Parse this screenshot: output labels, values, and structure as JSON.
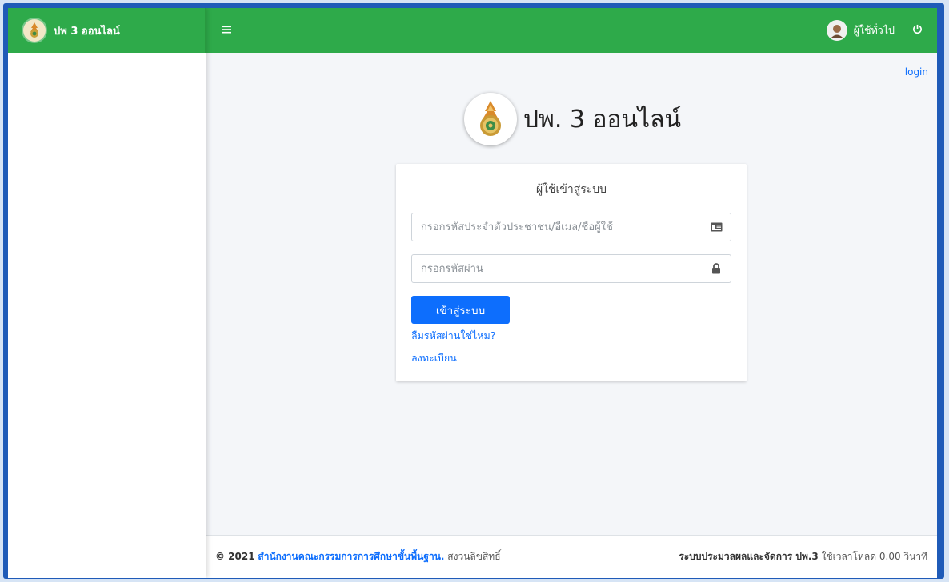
{
  "brand": {
    "title": "ปพ 3 ออนไลน์"
  },
  "navbar": {
    "menu_icon": "hamburger-icon",
    "user_label": "ผู้ใช้ทั่วไป",
    "power_icon": "power-icon"
  },
  "content": {
    "login_link": "login",
    "page_title": "ปพ. 3 ออนไลน์",
    "card": {
      "title": "ผู้ใช้เข้าสู่ระบบ",
      "username_placeholder": "กรอกรหัสประจำตัวประชาชน/อีเมล/ชื่อผู้ใช้",
      "username_value": "",
      "password_placeholder": "กรอกรหัสผ่าน",
      "password_value": "",
      "submit_label": "เข้าสู่ระบบ",
      "forgot_link": "ลืมรหัสผ่านใช่ไหม?",
      "register_link": "ลงทะเบียน"
    }
  },
  "footer": {
    "copyright": "© 2021",
    "org_link": "สำนักงานคณะกรรมการการศึกษาขั้นพื้นฐาน.",
    "rights": " สงวนลิขสิทธิ์",
    "system_name": "ระบบประมวลผลและจัดการ ปพ.3",
    "load_time": " ใช้เวลาโหลด 0.00 วินาที"
  },
  "colors": {
    "primary_green": "#2eaa4a",
    "accent_blue": "#0d6efd",
    "frame_blue": "#1f5bb8"
  }
}
